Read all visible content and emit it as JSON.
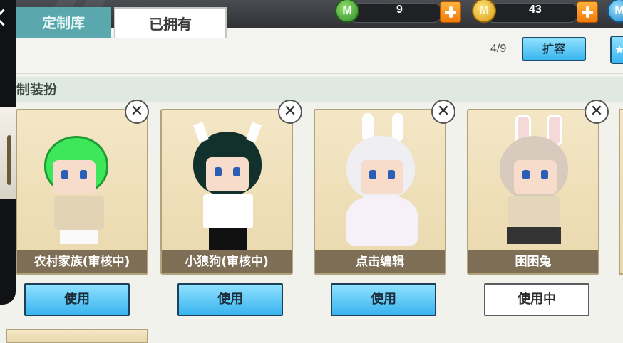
{
  "resources": [
    {
      "icon": "green-gem-icon",
      "value": "9"
    },
    {
      "icon": "gold-coin-icon",
      "value": "43"
    }
  ],
  "tabs": [
    {
      "label": "定制库",
      "state": "inactive"
    },
    {
      "label": "已拥有",
      "state": "active"
    }
  ],
  "capacity": "4/9",
  "expand_label": "扩容",
  "section_title": "定制装扮",
  "close_symbol": "✕",
  "outfits": [
    {
      "name": "农村家族(审核中)",
      "button": "使用",
      "in_use": false
    },
    {
      "name": "小狼狗(审核中)",
      "button": "使用",
      "in_use": false
    },
    {
      "name": "点击编辑",
      "button": "使用",
      "in_use": false
    },
    {
      "name": "困困兔",
      "button": "使用中",
      "in_use": true
    }
  ],
  "colors": {
    "tab_inactive": "#5aa8ad",
    "button_blue": "#3ab4ee",
    "card_bg": "#f4e7c6",
    "plus_orange": "#f07a0a"
  }
}
